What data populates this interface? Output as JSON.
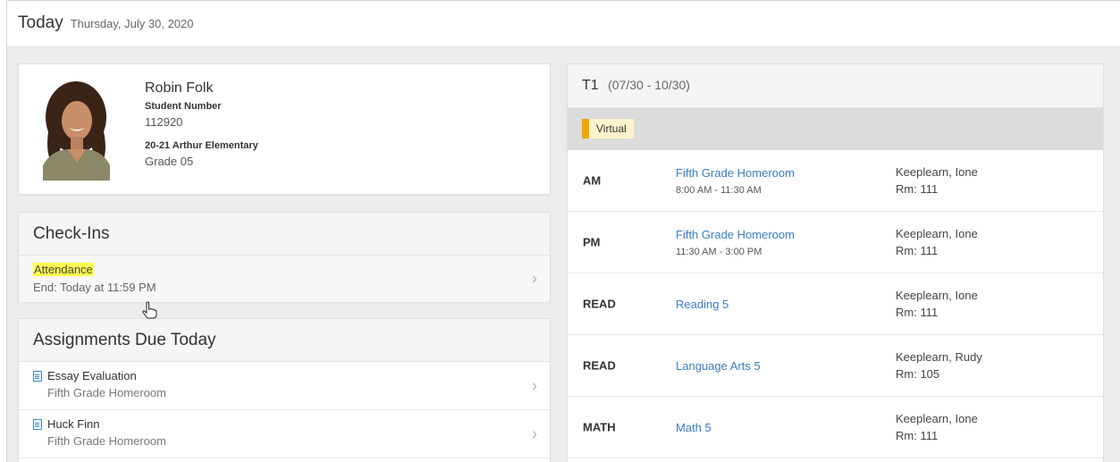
{
  "header": {
    "title": "Today",
    "date": "Thursday, July 30, 2020"
  },
  "profile": {
    "name": "Robin Folk",
    "student_number_label": "Student Number",
    "student_number": "112920",
    "school": "20-21 Arthur Elementary",
    "grade": "Grade 05"
  },
  "checkins": {
    "title": "Check-Ins",
    "items": [
      {
        "label": "Attendance",
        "end": "End: Today at 11:59 PM"
      }
    ]
  },
  "assignments": {
    "title": "Assignments Due Today",
    "items": [
      {
        "name": "Essay Evaluation",
        "course": "Fifth Grade Homeroom"
      },
      {
        "name": "Huck Finn",
        "course": "Fifth Grade Homeroom"
      }
    ]
  },
  "schedule": {
    "term": "T1",
    "range": "(07/30 - 10/30)",
    "badge": "Virtual",
    "periods": [
      {
        "code": "AM",
        "course": "Fifth Grade Homeroom",
        "time": "8:00 AM - 11:30 AM",
        "teacher": "Keeplearn, Ione",
        "room": "Rm: 111"
      },
      {
        "code": "PM",
        "course": "Fifth Grade Homeroom",
        "time": "11:30 AM - 3:00 PM",
        "teacher": "Keeplearn, Ione",
        "room": "Rm: 111"
      },
      {
        "code": "READ",
        "course": "Reading 5",
        "time": "",
        "teacher": "Keeplearn, Ione",
        "room": "Rm: 111"
      },
      {
        "code": "READ",
        "course": "Language Arts 5",
        "time": "",
        "teacher": "Keeplearn, Rudy",
        "room": "Rm: 105"
      },
      {
        "code": "MATH",
        "course": "Math 5",
        "time": "",
        "teacher": "Keeplearn, Ione",
        "room": "Rm: 111"
      }
    ]
  },
  "colors": {
    "link": "#3a7ec2",
    "highlight": "#ffff4d",
    "virtual_stripe": "#f0a800",
    "virtual_bg": "#fff3cc",
    "doc_icon": "#2f7fd2"
  },
  "icons": {
    "chevron": "chevron-right-icon",
    "document": "document-icon",
    "cursor": "hand-pointer-cursor"
  }
}
